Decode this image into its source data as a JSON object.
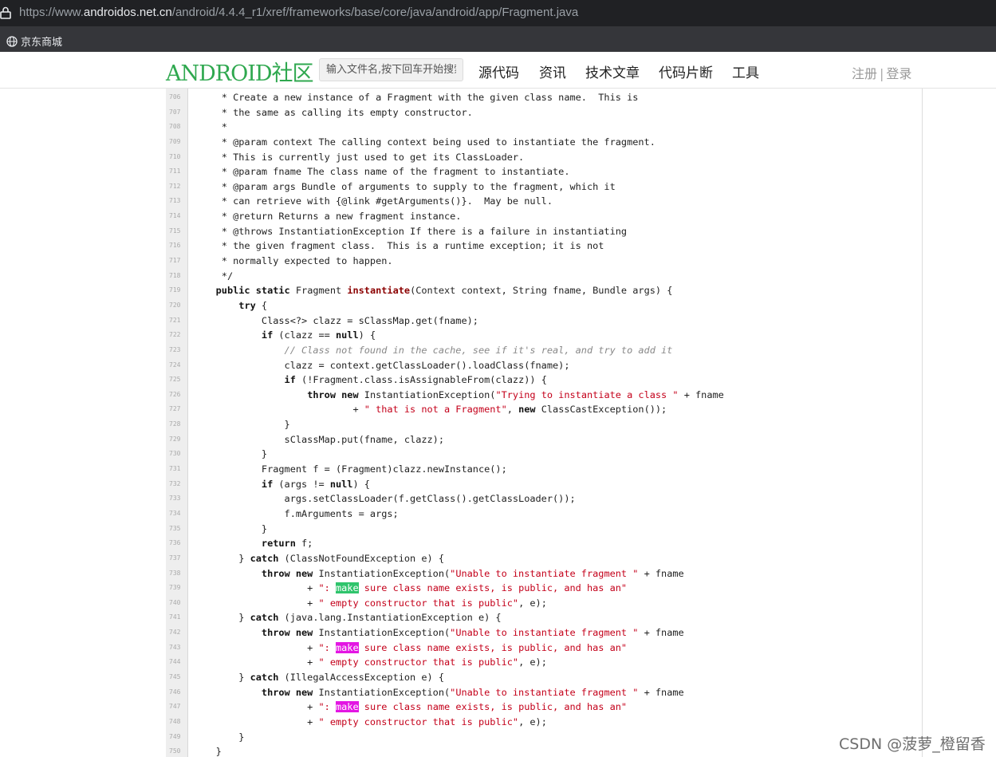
{
  "browser": {
    "url_prefix": "https://www.",
    "url_domain": "androidos.net.cn",
    "url_path": "/android/4.4.4_r1/xref/frameworks/base/core/java/android/app/Fragment.java",
    "bookmark_label": "京东商城"
  },
  "site": {
    "logo": "ANDROID社区",
    "search_placeholder": "输入文件名,按下回车开始搜索",
    "nav": [
      "源代码",
      "资讯",
      "技术文章",
      "代码片断",
      "工具"
    ],
    "register": "注册",
    "separator": "|",
    "login": "登录"
  },
  "code": {
    "lines": [
      {
        "num": "706",
        "segs": [
          {
            "t": "     * Create a new instance of a Fragment with the given class name.  This is"
          }
        ]
      },
      {
        "num": "707",
        "segs": [
          {
            "t": "     * the same as calling its empty constructor."
          }
        ]
      },
      {
        "num": "708",
        "segs": [
          {
            "t": "     *"
          }
        ]
      },
      {
        "num": "709",
        "segs": [
          {
            "t": "     * @param context The calling context being used to instantiate the fragment."
          }
        ]
      },
      {
        "num": "710",
        "segs": [
          {
            "t": "     * This is currently just used to get its ClassLoader."
          }
        ]
      },
      {
        "num": "711",
        "segs": [
          {
            "t": "     * @param fname The class name of the fragment to instantiate."
          }
        ]
      },
      {
        "num": "712",
        "segs": [
          {
            "t": "     * @param args Bundle of arguments to supply to the fragment, which it"
          }
        ]
      },
      {
        "num": "713",
        "segs": [
          {
            "t": "     * can retrieve with {@link #getArguments()}.  May be null."
          }
        ]
      },
      {
        "num": "714",
        "segs": [
          {
            "t": "     * @return Returns a new fragment instance."
          }
        ]
      },
      {
        "num": "715",
        "segs": [
          {
            "t": "     * @throws InstantiationException If there is a failure in instantiating"
          }
        ]
      },
      {
        "num": "716",
        "segs": [
          {
            "t": "     * the given fragment class.  This is a runtime exception; it is not"
          }
        ]
      },
      {
        "num": "717",
        "segs": [
          {
            "t": "     * normally expected to happen."
          }
        ]
      },
      {
        "num": "718",
        "segs": [
          {
            "t": "     */"
          }
        ]
      },
      {
        "num": "719",
        "segs": [
          {
            "t": "    "
          },
          {
            "t": "public static",
            "c": "kw"
          },
          {
            "t": " Fragment "
          },
          {
            "t": "instantiate",
            "c": "fn"
          },
          {
            "t": "(Context context, String fname, Bundle args) {"
          }
        ]
      },
      {
        "num": "720",
        "segs": [
          {
            "t": "        "
          },
          {
            "t": "try",
            "c": "kw"
          },
          {
            "t": " {"
          }
        ]
      },
      {
        "num": "721",
        "segs": [
          {
            "t": "            Class<?> clazz = sClassMap.get(fname);"
          }
        ]
      },
      {
        "num": "722",
        "segs": [
          {
            "t": "            "
          },
          {
            "t": "if",
            "c": "kw"
          },
          {
            "t": " (clazz == "
          },
          {
            "t": "null",
            "c": "kw"
          },
          {
            "t": ") {"
          }
        ]
      },
      {
        "num": "723",
        "segs": [
          {
            "t": "                "
          },
          {
            "t": "// Class not found in the cache, see if it's real, and try to add it",
            "c": "cm"
          }
        ]
      },
      {
        "num": "724",
        "segs": [
          {
            "t": "                clazz = context.getClassLoader().loadClass(fname);"
          }
        ]
      },
      {
        "num": "725",
        "segs": [
          {
            "t": "                "
          },
          {
            "t": "if",
            "c": "kw"
          },
          {
            "t": " (!Fragment.class.isAssignableFrom(clazz)) {"
          }
        ]
      },
      {
        "num": "726",
        "segs": [
          {
            "t": "                    "
          },
          {
            "t": "throw new",
            "c": "kw"
          },
          {
            "t": " InstantiationException("
          },
          {
            "t": "\"Trying to instantiate a class \"",
            "c": "str"
          },
          {
            "t": " + fname"
          }
        ]
      },
      {
        "num": "727",
        "segs": [
          {
            "t": "                            + "
          },
          {
            "t": "\" that is not a Fragment\"",
            "c": "str"
          },
          {
            "t": ", "
          },
          {
            "t": "new",
            "c": "kw"
          },
          {
            "t": " ClassCastException());"
          }
        ]
      },
      {
        "num": "728",
        "segs": [
          {
            "t": "                }"
          }
        ]
      },
      {
        "num": "729",
        "segs": [
          {
            "t": "                sClassMap.put(fname, clazz);"
          }
        ]
      },
      {
        "num": "730",
        "segs": [
          {
            "t": "            }"
          }
        ]
      },
      {
        "num": "731",
        "segs": [
          {
            "t": "            Fragment f = (Fragment)clazz.newInstance();"
          }
        ]
      },
      {
        "num": "732",
        "segs": [
          {
            "t": "            "
          },
          {
            "t": "if",
            "c": "kw"
          },
          {
            "t": " (args != "
          },
          {
            "t": "null",
            "c": "kw"
          },
          {
            "t": ") {"
          }
        ]
      },
      {
        "num": "733",
        "segs": [
          {
            "t": "                args.setClassLoader(f.getClass().getClassLoader());"
          }
        ]
      },
      {
        "num": "734",
        "segs": [
          {
            "t": "                f.mArguments = args;"
          }
        ]
      },
      {
        "num": "735",
        "segs": [
          {
            "t": "            }"
          }
        ]
      },
      {
        "num": "736",
        "segs": [
          {
            "t": "            "
          },
          {
            "t": "return",
            "c": "kw"
          },
          {
            "t": " f;"
          }
        ]
      },
      {
        "num": "737",
        "segs": [
          {
            "t": "        } "
          },
          {
            "t": "catch",
            "c": "kw"
          },
          {
            "t": " (ClassNotFoundException e) {"
          }
        ]
      },
      {
        "num": "738",
        "segs": [
          {
            "t": "            "
          },
          {
            "t": "throw new",
            "c": "kw"
          },
          {
            "t": " InstantiationException("
          },
          {
            "t": "\"Unable to instantiate fragment \"",
            "c": "str"
          },
          {
            "t": " + fname"
          }
        ]
      },
      {
        "num": "739",
        "segs": [
          {
            "t": "                    + "
          },
          {
            "t": "\": ",
            "c": "str"
          },
          {
            "t": "make",
            "c": "hl-green"
          },
          {
            "t": " sure class name exists, is public, and has an\"",
            "c": "str"
          }
        ]
      },
      {
        "num": "740",
        "segs": [
          {
            "t": "                    + "
          },
          {
            "t": "\" empty constructor that is public\"",
            "c": "str"
          },
          {
            "t": ", e);"
          }
        ]
      },
      {
        "num": "741",
        "segs": [
          {
            "t": "        } "
          },
          {
            "t": "catch",
            "c": "kw"
          },
          {
            "t": " (java.lang.InstantiationException e) {"
          }
        ]
      },
      {
        "num": "742",
        "segs": [
          {
            "t": "            "
          },
          {
            "t": "throw new",
            "c": "kw"
          },
          {
            "t": " InstantiationException("
          },
          {
            "t": "\"Unable to instantiate fragment \"",
            "c": "str"
          },
          {
            "t": " + fname"
          }
        ]
      },
      {
        "num": "743",
        "segs": [
          {
            "t": "                    + "
          },
          {
            "t": "\": ",
            "c": "str"
          },
          {
            "t": "make",
            "c": "hl-magenta"
          },
          {
            "t": " sure class name exists, is public, and has an\"",
            "c": "str"
          }
        ]
      },
      {
        "num": "744",
        "segs": [
          {
            "t": "                    + "
          },
          {
            "t": "\" empty constructor that is public\"",
            "c": "str"
          },
          {
            "t": ", e);"
          }
        ]
      },
      {
        "num": "745",
        "segs": [
          {
            "t": "        } "
          },
          {
            "t": "catch",
            "c": "kw"
          },
          {
            "t": " (IllegalAccessException e) {"
          }
        ]
      },
      {
        "num": "746",
        "segs": [
          {
            "t": "            "
          },
          {
            "t": "throw new",
            "c": "kw"
          },
          {
            "t": " InstantiationException("
          },
          {
            "t": "\"Unable to instantiate fragment \"",
            "c": "str"
          },
          {
            "t": " + fname"
          }
        ]
      },
      {
        "num": "747",
        "segs": [
          {
            "t": "                    + "
          },
          {
            "t": "\": ",
            "c": "str"
          },
          {
            "t": "make",
            "c": "hl-magenta"
          },
          {
            "t": " sure class name exists, is public, and has an\"",
            "c": "str"
          }
        ]
      },
      {
        "num": "748",
        "segs": [
          {
            "t": "                    + "
          },
          {
            "t": "\" empty constructor that is public\"",
            "c": "str"
          },
          {
            "t": ", e);"
          }
        ]
      },
      {
        "num": "749",
        "segs": [
          {
            "t": "        }"
          }
        ]
      },
      {
        "num": "750",
        "segs": [
          {
            "t": "    }"
          }
        ]
      }
    ]
  },
  "watermark": "CSDN @菠萝_橙留香",
  "colors": {
    "logo": "#2fa84f",
    "highlight_green": "#2fc46c",
    "highlight_magenta": "#e316e3",
    "string": "#c4001a",
    "comment": "#888888"
  }
}
